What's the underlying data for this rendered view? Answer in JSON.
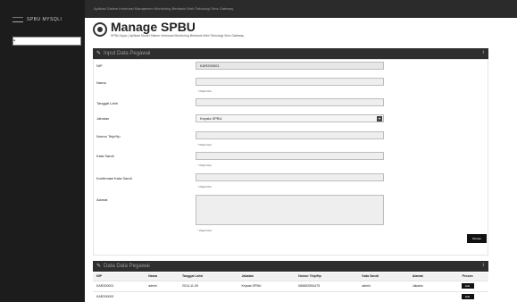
{
  "sidebar": {
    "brand": "SPBU MYSQLI",
    "search_placeholder": ""
  },
  "topbar": {
    "text": "Aplikasi Sistem Informasi Manajemen Monitoring Berbasis Web Teknologi Sms Gateway"
  },
  "header": {
    "title": "Manage SPBU",
    "subtitle": "SPBU Apps | Aplikasi Model Sistem Informasi Monitoring Berbasis Web Teknologi Sms Gateway"
  },
  "form_panel": {
    "title": "Input Data Pegawai"
  },
  "form": {
    "fields": [
      {
        "label": "NIP",
        "value": "KAR200001",
        "hint": ""
      },
      {
        "label": "Nama",
        "value": "",
        "hint": "* Wajib Diisi"
      },
      {
        "label": "Tanggal Lahir",
        "value": "",
        "hint": ""
      },
      {
        "label": "Jabatan",
        "value": "Kepala SPBU",
        "hint": ""
      },
      {
        "label": "Nomor Telp/Hp",
        "value": "",
        "hint": "* Wajib Diisi"
      },
      {
        "label": "Kata Sandi",
        "value": "",
        "hint": "* Wajib Diisi"
      },
      {
        "label": "Konfirmasi Kata Sandi",
        "value": "",
        "hint": "* Wajib Diisi"
      },
      {
        "label": "Alamat",
        "value": "",
        "hint": "* Wajib Diisi"
      }
    ],
    "submit_label": "Simpan"
  },
  "table_panel": {
    "title": "Data Data Pegawai"
  },
  "table": {
    "headers": [
      "NIP",
      "Nama",
      "Tanggal Lahir",
      "Jabatan",
      "Nomor Telp/Hp",
      "Kata Sandi",
      "Alamat",
      "Proses"
    ],
    "rows": [
      [
        "KAR200001",
        "admin",
        "2014-11-09",
        "Kepala SPBU",
        "085852594475",
        "admin",
        "Jakarta",
        "Edit"
      ],
      [
        "KAR200002",
        "",
        "",
        "",
        "",
        "",
        "",
        "Edit"
      ]
    ]
  }
}
